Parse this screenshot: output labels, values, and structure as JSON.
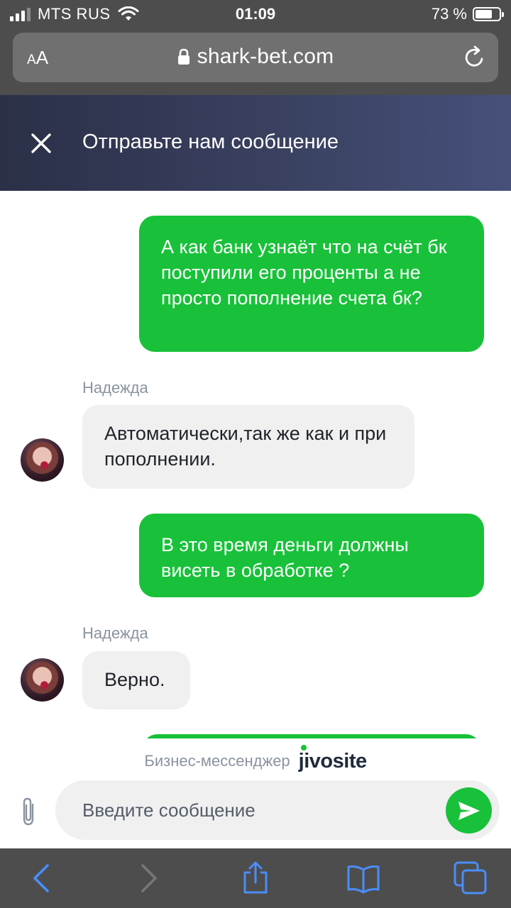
{
  "status_bar": {
    "carrier": "MTS RUS",
    "time": "01:09",
    "battery": "73 %",
    "battery_level": 0.73
  },
  "browser": {
    "text_size_label_small": "A",
    "text_size_label_large": "A",
    "url": "shark-bet.com"
  },
  "chat": {
    "header_title": "Отправьте нам сообщение",
    "messages": [
      {
        "direction": "out",
        "text": "А как банк узнаёт что на счёт бк поступили его проценты а не просто пополнение счета бк?"
      },
      {
        "direction": "in",
        "sender": "Надежда",
        "text": "Автоматически,так же как и при пополнении."
      },
      {
        "direction": "out",
        "text": "В это время деньги должны висеть в обработке ?"
      },
      {
        "direction": "in",
        "sender": "Надежда",
        "text": "Верно."
      }
    ],
    "branding_label": "Бизнес-мессенджер",
    "branding_logo": "jivosite",
    "input_placeholder": "Введите сообщение"
  },
  "colors": {
    "outgoing_bubble": "#18c139",
    "incoming_bubble": "#f0f0f1",
    "header_gradient_start": "#2b3048",
    "header_gradient_end": "#46507a",
    "safari_chrome": "#4d4d4d",
    "toolbar_accent": "#4a8df8"
  }
}
